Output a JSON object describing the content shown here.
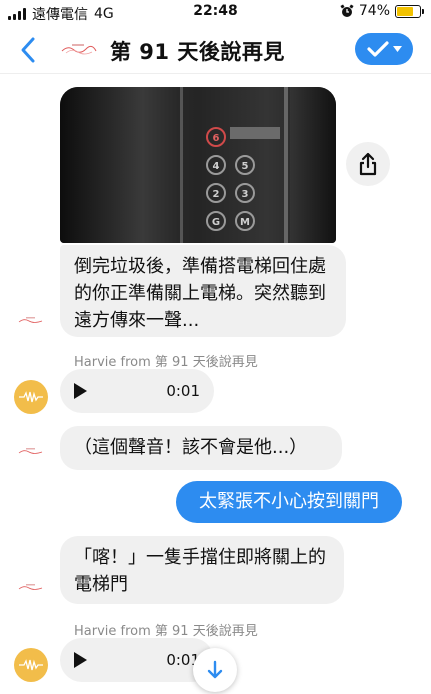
{
  "status_bar": {
    "carrier": "遠傳電信",
    "network": "4G",
    "time": "22:48",
    "battery": "74%",
    "battery_level": 0.74
  },
  "header": {
    "title": "第 91 天後說再見"
  },
  "messages": {
    "text1": "倒完垃圾後，準備搭電梯回住處的你正準備關上電梯。突然聽到遠方傳來一聲...",
    "sender1": "Harvie from 第 91 天後說再見",
    "voice1_duration": "0:01",
    "text2": "（這個聲音！該不會是他...）",
    "outgoing": "太緊張不小心按到關門",
    "text3": "「喀！」一隻手擋住即將關上的電梯門",
    "sender2": "Harvie from 第 91 天後說再見",
    "voice2_duration": "0:01"
  },
  "elevator_buttons": [
    "6",
    "4",
    "5",
    "2",
    "3",
    "G",
    "M"
  ],
  "colors": {
    "accent": "#2d8cf0",
    "bubble": "#f0f0f0",
    "avatar": "#f2bd4a",
    "logo": "#e05a5a"
  }
}
